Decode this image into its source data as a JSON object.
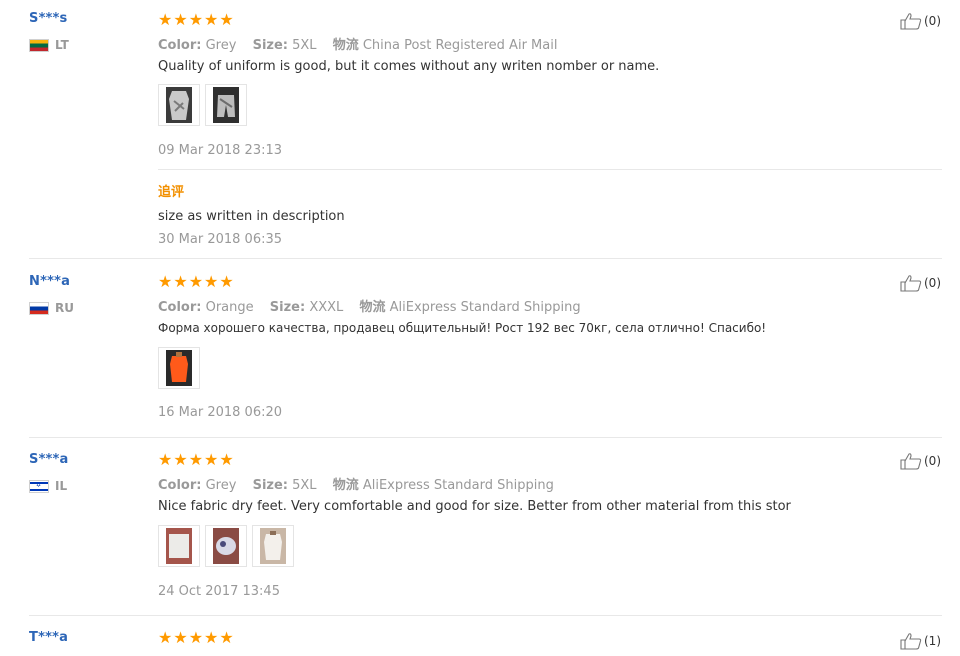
{
  "labels": {
    "color": "Color:",
    "size": "Size:",
    "logistics": "物流"
  },
  "reviews": [
    {
      "user": "S***s",
      "country": "LT",
      "stars": 5,
      "color": "Grey",
      "size": "5XL",
      "shipping": "China Post Registered Air Mail",
      "text": "Quality of uniform is good, but it comes without any writen nomber or name.",
      "date": "09 Mar 2018 23:13",
      "helpful": "(0)",
      "followup": {
        "label": "追评",
        "text": "size as written in description",
        "date": "30 Mar 2018 06:35"
      }
    },
    {
      "user": "N***a",
      "country": "RU",
      "stars": 5,
      "color": "Orange",
      "size": "XXXL",
      "shipping": "AliExpress Standard Shipping",
      "text": "Форма хорошего качества, продавец общительный! Рост 192 вес 70кг, села отлично! Спасибо!",
      "date": "16 Mar 2018 06:20",
      "helpful": "(0)"
    },
    {
      "user": "S***a",
      "country": "IL",
      "stars": 5,
      "color": "Grey",
      "size": "5XL",
      "shipping": "AliExpress Standard Shipping",
      "text": "Nice fabric dry feet. Very comfortable and good for size. Better from other material from this stor",
      "date": "24 Oct 2017 13:45",
      "helpful": "(0)"
    },
    {
      "user": "T***a",
      "stars": 5,
      "helpful": "(1)"
    }
  ],
  "colors": {
    "star": "#ff9a00",
    "username": "#2d66b7",
    "followup": "#f29000"
  }
}
